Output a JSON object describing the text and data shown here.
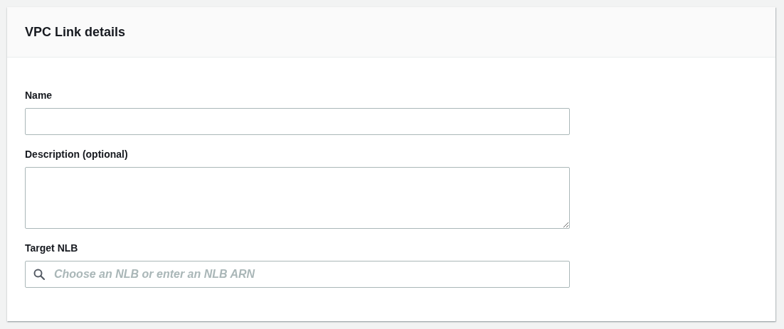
{
  "panel": {
    "title": "VPC Link details"
  },
  "fields": [
    {
      "kind": "text",
      "label": "Name"
    },
    {
      "kind": "textarea",
      "label": "Description (optional)"
    },
    {
      "kind": "search",
      "label": "Target NLB",
      "placeholder": "Choose an NLB or enter an NLB ARN"
    }
  ]
}
